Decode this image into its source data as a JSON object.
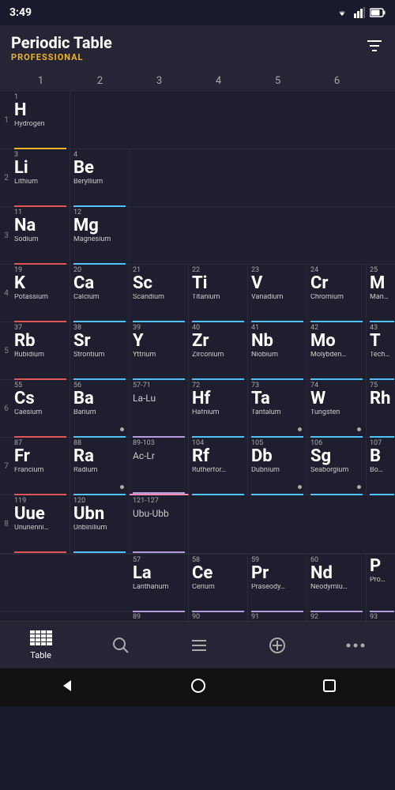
{
  "statusBar": {
    "time": "3:49"
  },
  "header": {
    "title": "Periodic Table",
    "subtitle": "PROFESSIONAL",
    "filterLabel": "filter"
  },
  "colHeaders": [
    "1",
    "2",
    "3",
    "4",
    "5",
    "6"
  ],
  "rowNumbers": [
    "1",
    "2",
    "3",
    "4",
    "5",
    "6",
    "7",
    "8"
  ],
  "bottomNav": {
    "items": [
      {
        "label": "Table",
        "icon": "⊞",
        "active": true
      },
      {
        "label": "",
        "icon": "🔍",
        "active": false
      },
      {
        "label": "",
        "icon": "≡",
        "active": false
      },
      {
        "label": "",
        "icon": "⊕",
        "active": false
      },
      {
        "label": "",
        "icon": "···",
        "active": false
      }
    ]
  }
}
